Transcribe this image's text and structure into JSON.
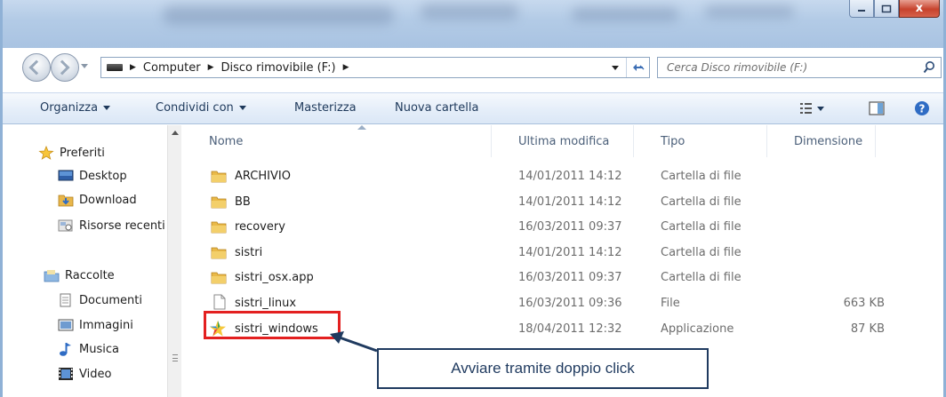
{
  "window": {
    "controls": {
      "minimize": "minimize",
      "maximize": "maximize",
      "close": "x"
    }
  },
  "address_bar": {
    "breadcrumbs": [
      "Computer",
      "Disco rimovibile (F:)"
    ]
  },
  "search": {
    "placeholder": "Cerca Disco rimovibile (F:)"
  },
  "toolbar": {
    "organize": "Organizza",
    "share": "Condividi con",
    "burn": "Masterizza",
    "new_folder": "Nuova cartella"
  },
  "sidebar": {
    "favorites_header": "Preferiti",
    "favorites": [
      "Desktop",
      "Download",
      "Risorse recenti"
    ],
    "libraries_header": "Raccolte",
    "libraries": [
      "Documenti",
      "Immagini",
      "Musica",
      "Video"
    ]
  },
  "columns": {
    "name": "Nome",
    "modified": "Ultima modifica",
    "type": "Tipo",
    "size": "Dimensione"
  },
  "files": [
    {
      "name": "ARCHIVIO",
      "modified": "14/01/2011 14:12",
      "type": "Cartella di file",
      "size": "",
      "icon": "folder-icon"
    },
    {
      "name": "BB",
      "modified": "14/01/2011 14:12",
      "type": "Cartella di file",
      "size": "",
      "icon": "folder-icon"
    },
    {
      "name": "recovery",
      "modified": "16/03/2011 09:37",
      "type": "Cartella di file",
      "size": "",
      "icon": "folder-icon"
    },
    {
      "name": "sistri",
      "modified": "14/01/2011 14:12",
      "type": "Cartella di file",
      "size": "",
      "icon": "folder-icon"
    },
    {
      "name": "sistri_osx.app",
      "modified": "16/03/2011 09:37",
      "type": "Cartella di file",
      "size": "",
      "icon": "folder-icon"
    },
    {
      "name": "sistri_linux",
      "modified": "16/03/2011 09:36",
      "type": "File",
      "size": "663 KB",
      "icon": "file-icon"
    },
    {
      "name": "sistri_windows",
      "modified": "18/04/2011 12:32",
      "type": "Applicazione",
      "size": "87 KB",
      "icon": "app-star-icon"
    }
  ],
  "callout": {
    "text": "Avviare tramite doppio click"
  },
  "colors": {
    "highlight": "#e32020",
    "callout_border": "#1f3a5f",
    "toolbar_text": "#1e395b"
  }
}
